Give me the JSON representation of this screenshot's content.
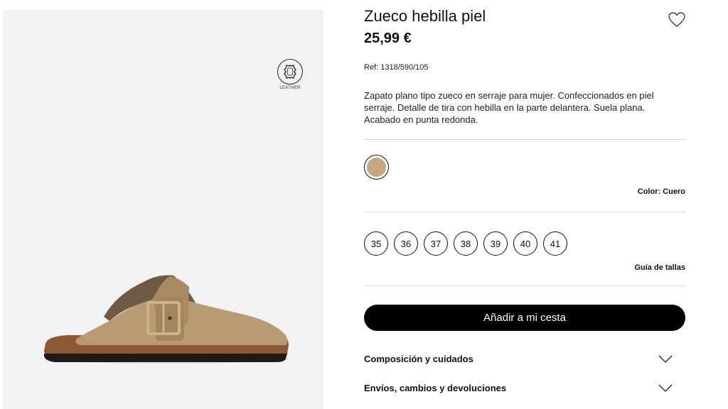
{
  "product": {
    "title": "Zueco hebilla piel",
    "price": "25,99 €",
    "ref": "Ref: 1318/590/105",
    "description": "Zapato plano tipo zueco en serraje para mujer. Confeccionados en piel serraje. Detalle de tira con hebilla en la parte delantera. Suela plana. Acabado en punta redonda."
  },
  "gallery": {
    "badge_text": "LEATHER"
  },
  "colors": {
    "label": "Color: Cuero",
    "swatch_hex": "#c8a77e"
  },
  "sizes": {
    "options": [
      "35",
      "36",
      "37",
      "38",
      "39",
      "40",
      "41"
    ],
    "guide_label": "Guía de tallas"
  },
  "actions": {
    "add_to_cart": "Añadir a mi cesta",
    "favorite_icon": "heart-icon"
  },
  "accordions": [
    {
      "label": "Composición y cuidados"
    },
    {
      "label": "Envíos, cambios y devoluciones"
    }
  ]
}
